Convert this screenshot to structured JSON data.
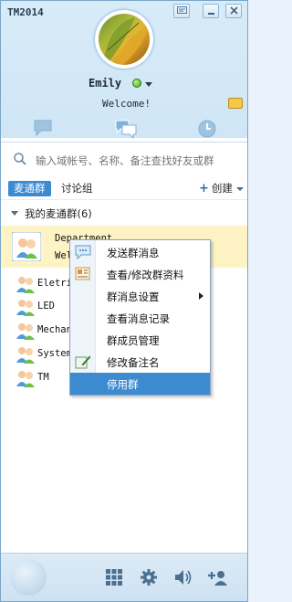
{
  "app": {
    "title": "TM2014"
  },
  "profile": {
    "name": "Emily",
    "status_color": "#3fa51e",
    "signature": "Welcome!"
  },
  "main_tabs": [
    {
      "name": "conversations",
      "icon": "chat-bubble-icon"
    },
    {
      "name": "groups",
      "icon": "group-chat-icon",
      "active": true
    },
    {
      "name": "recent",
      "icon": "clock-icon"
    }
  ],
  "search": {
    "placeholder": "输入域帐号、名称、备注查找好友或群"
  },
  "group_tabs": {
    "active": "麦通群",
    "other": "讨论组",
    "create": "创建"
  },
  "section": {
    "title": "我的麦通群(6)"
  },
  "groups": [
    {
      "name": "Department",
      "subtitle": "Welcome"
    },
    {
      "name": "Eletri"
    },
    {
      "name": "LED"
    },
    {
      "name": "Mechan"
    },
    {
      "name": "System"
    },
    {
      "name": "TM"
    }
  ],
  "context_menu": {
    "items": [
      {
        "label": "发送群消息",
        "icon": "message-icon"
      },
      {
        "label": "查看/修改群资料",
        "icon": "profile-card-icon"
      },
      {
        "label": "群消息设置",
        "has_submenu": true
      },
      {
        "label": "查看消息记录"
      },
      {
        "label": "群成员管理"
      },
      {
        "label": "修改备注名",
        "icon": "edit-icon"
      },
      {
        "label": "停用群",
        "highlighted": true
      }
    ]
  },
  "bottom_toolbar": [
    "apps-grid-icon",
    "settings-icon",
    "volume-icon",
    "add-contact-icon"
  ],
  "colors": {
    "accent": "#3c8ad0",
    "selected_row": "#fdf3c4"
  }
}
